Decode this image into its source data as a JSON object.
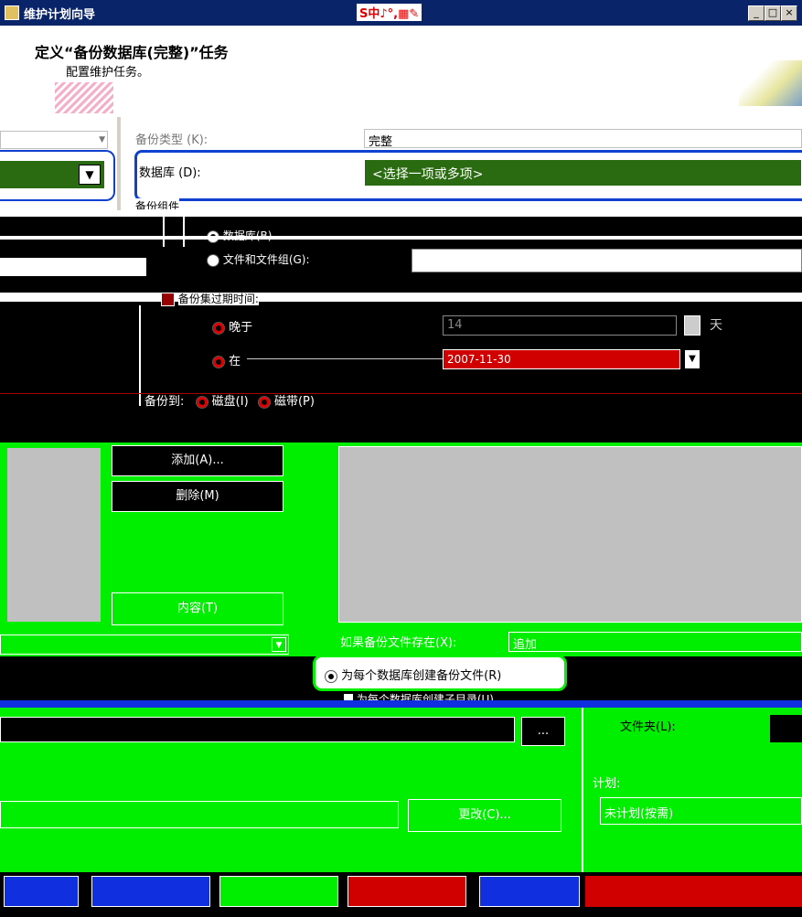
{
  "window": {
    "title": "维护计划向导",
    "ime": "S中♪°,▦✎"
  },
  "header": {
    "title": "定义“备份数据库(完整)”任务",
    "subtitle": "配置维护任务。"
  },
  "backup_type": {
    "label": "备份类型 (K):",
    "value": "完整"
  },
  "database": {
    "label": "数据库 (D):",
    "value": "<选择一项或多项>"
  },
  "backup_component": {
    "label": "备份组件",
    "opt_database": "数据库(B)",
    "opt_files": "文件和文件组(G):"
  },
  "expire": {
    "label": "备份集过期时间:",
    "after_label": "晚于",
    "after_value": "14",
    "unit": "天",
    "on_label": "在",
    "on_value": "2007-11-30"
  },
  "backup_to": {
    "label": "备份到:",
    "disk": "磁盘(I)",
    "tape": "磁带(P)"
  },
  "buttons": {
    "add": "添加(A)...",
    "remove": "删除(M)",
    "contents": "内容(T)",
    "browse": "...",
    "change": "更改(C)..."
  },
  "if_exists": {
    "label": "如果备份文件存在(X):",
    "value": "追加"
  },
  "per_db": {
    "label": "为每个数据库创建备份文件(R)",
    "subdir": "为每个数据库创建子目录(U)"
  },
  "folder_label": "文件夹(L):",
  "schedule": {
    "label": "计划:",
    "value": "未计划(按需)"
  }
}
